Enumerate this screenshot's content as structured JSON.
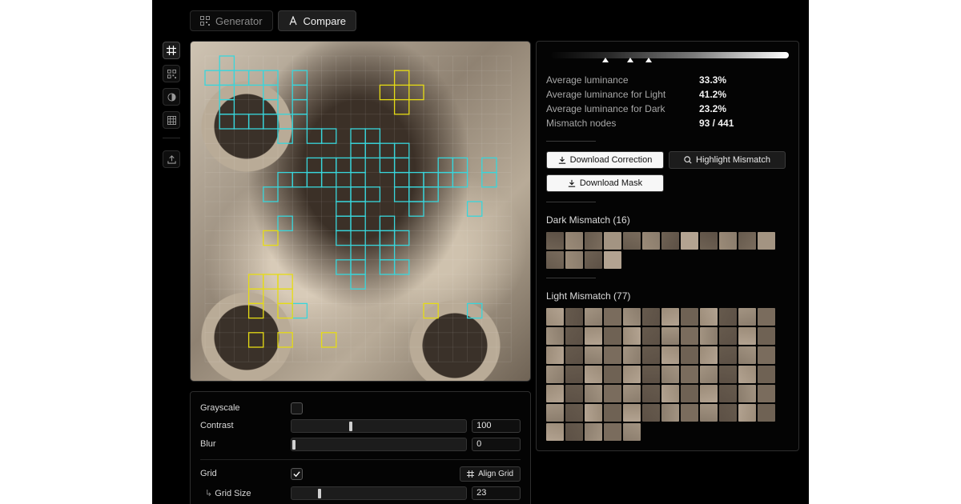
{
  "tabs": [
    {
      "label": "Generator",
      "icon": "qr-code-icon",
      "active": false
    },
    {
      "label": "Compare",
      "icon": "compare-icon",
      "active": true
    }
  ],
  "toolbar": {
    "tools": [
      "grid-crop-icon",
      "qr-code-icon",
      "contrast-icon",
      "grid-icon"
    ],
    "upload": "upload-icon"
  },
  "qr": {
    "grid_size": 21,
    "light_mismatch": [
      [
        1,
        0
      ],
      [
        0,
        1
      ],
      [
        1,
        1
      ],
      [
        2,
        1
      ],
      [
        3,
        1
      ],
      [
        4,
        1
      ],
      [
        6,
        1
      ],
      [
        1,
        2
      ],
      [
        4,
        2
      ],
      [
        6,
        2
      ],
      [
        1,
        3
      ],
      [
        4,
        3
      ],
      [
        6,
        3
      ],
      [
        1,
        4
      ],
      [
        2,
        4
      ],
      [
        3,
        4
      ],
      [
        4,
        4
      ],
      [
        5,
        4
      ],
      [
        6,
        4
      ],
      [
        5,
        5
      ],
      [
        7,
        5
      ],
      [
        8,
        5
      ],
      [
        10,
        5
      ],
      [
        11,
        5
      ],
      [
        10,
        6
      ],
      [
        11,
        6
      ],
      [
        12,
        6
      ],
      [
        13,
        6
      ],
      [
        7,
        7
      ],
      [
        8,
        7
      ],
      [
        9,
        7
      ],
      [
        10,
        7
      ],
      [
        12,
        7
      ],
      [
        13,
        7
      ],
      [
        16,
        7
      ],
      [
        17,
        7
      ],
      [
        19,
        7
      ],
      [
        5,
        8
      ],
      [
        6,
        8
      ],
      [
        7,
        8
      ],
      [
        8,
        8
      ],
      [
        10,
        8
      ],
      [
        13,
        8
      ],
      [
        14,
        8
      ],
      [
        15,
        8
      ],
      [
        16,
        8
      ],
      [
        17,
        8
      ],
      [
        19,
        8
      ],
      [
        4,
        9
      ],
      [
        9,
        9
      ],
      [
        10,
        9
      ],
      [
        11,
        9
      ],
      [
        13,
        9
      ],
      [
        14,
        9
      ],
      [
        15,
        9
      ],
      [
        9,
        10
      ],
      [
        10,
        10
      ],
      [
        14,
        10
      ],
      [
        18,
        10
      ],
      [
        5,
        11
      ],
      [
        9,
        11
      ],
      [
        10,
        11
      ],
      [
        12,
        11
      ],
      [
        9,
        12
      ],
      [
        11,
        12
      ],
      [
        12,
        12
      ],
      [
        13,
        12
      ],
      [
        10,
        13
      ],
      [
        12,
        13
      ],
      [
        9,
        14
      ],
      [
        10,
        14
      ],
      [
        12,
        14
      ],
      [
        13,
        14
      ],
      [
        10,
        15
      ],
      [
        6,
        17
      ],
      [
        18,
        17
      ]
    ],
    "dark_mismatch": [
      [
        13,
        1
      ],
      [
        12,
        2
      ],
      [
        14,
        2
      ],
      [
        13,
        3
      ],
      [
        4,
        12
      ],
      [
        3,
        15
      ],
      [
        4,
        15
      ],
      [
        5,
        15
      ],
      [
        3,
        16
      ],
      [
        5,
        16
      ],
      [
        3,
        17
      ],
      [
        5,
        17
      ],
      [
        15,
        17
      ],
      [
        3,
        19
      ],
      [
        5,
        19
      ],
      [
        8,
        19
      ]
    ],
    "colors": {
      "light": "#38d6dc",
      "dark": "#e6dc14"
    }
  },
  "controls": {
    "grayscale": {
      "label": "Grayscale",
      "checked": false
    },
    "contrast": {
      "label": "Contrast",
      "value": "100",
      "level": 0.33
    },
    "blur": {
      "label": "Blur",
      "value": "0",
      "level": 0
    },
    "grid": {
      "label": "Grid",
      "checked": true,
      "button": "Align Grid"
    },
    "grid_size": {
      "label": "Grid Size",
      "value": "23",
      "level": 0.15
    }
  },
  "stats": {
    "luminance_markers": [
      0.23,
      0.333,
      0.412
    ],
    "rows": [
      {
        "label": "Average luminance",
        "value": "33.3%"
      },
      {
        "label": "Average luminance for Light",
        "value": "41.2%"
      },
      {
        "label": "Average luminance for Dark",
        "value": "23.2%"
      },
      {
        "label": "Mismatch nodes",
        "value": "93 / 441"
      }
    ],
    "buttons": {
      "download_correction": "Download Correction",
      "highlight_mismatch": "Highlight Mismatch",
      "download_mask": "Download Mask"
    },
    "dark_title": "Dark Mismatch (16)",
    "light_title": "Light Mismatch (77)",
    "dark_count": 16,
    "light_count": 77
  }
}
